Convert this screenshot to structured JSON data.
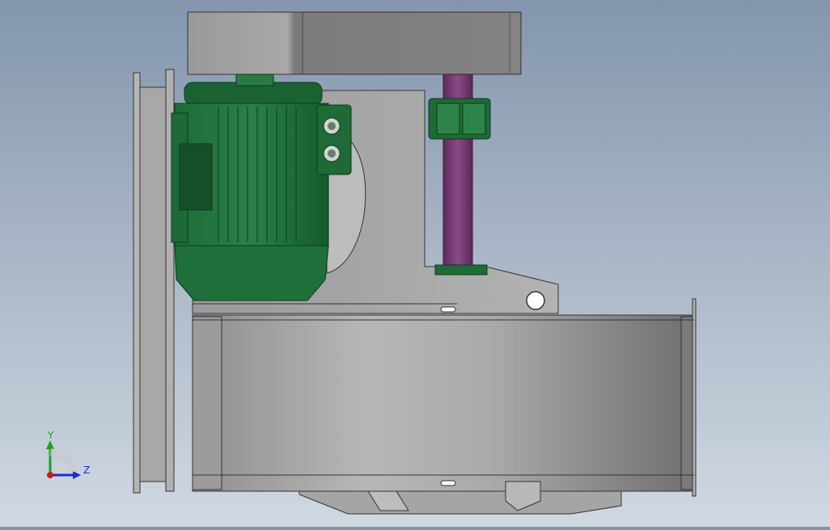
{
  "viewport": {
    "background_top": "#8396ae",
    "background_bottom": "#d0d8e2"
  },
  "model": {
    "motor_color": "#1f6b3a",
    "shaft_color": "#7a3a78",
    "housing_color": "#a6a6a6"
  },
  "triad": {
    "y_label": "Y",
    "z_label": "Z",
    "y_color": "#1fa01f",
    "z_color": "#1a2fd0",
    "x_color": "#d01a1a"
  }
}
